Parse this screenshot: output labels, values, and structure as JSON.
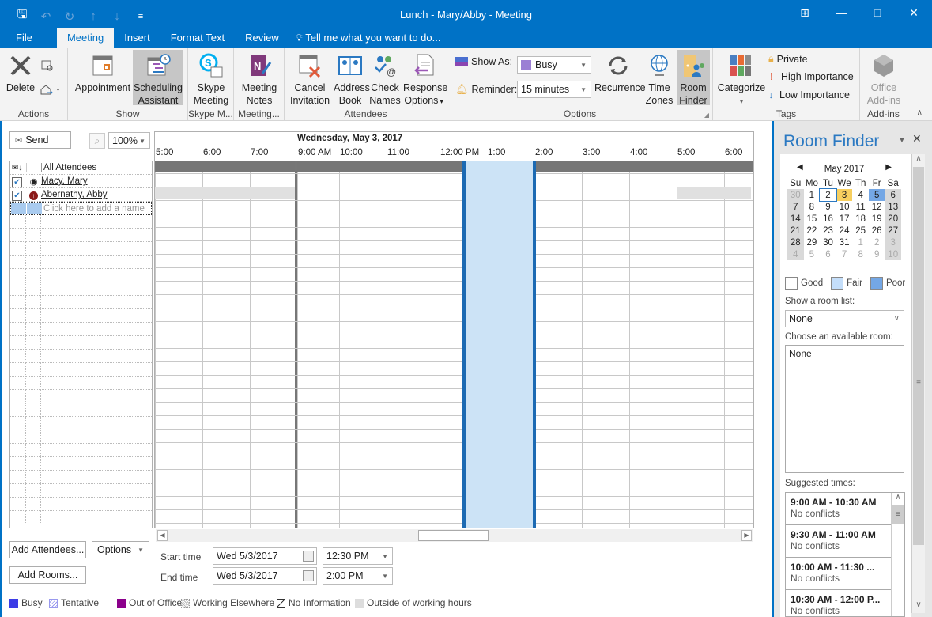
{
  "window": {
    "title": "Lunch - Mary/Abby - Meeting",
    "controls": [
      "restore-ribbon",
      "minimize",
      "maximize",
      "close"
    ]
  },
  "qat": {
    "icons": [
      "save-icon",
      "undo-icon",
      "redo-icon",
      "up-icon",
      "down-icon",
      "customize-icon"
    ]
  },
  "tabs": [
    {
      "label": "File"
    },
    {
      "label": "Meeting"
    },
    {
      "label": "Insert"
    },
    {
      "label": "Format Text"
    },
    {
      "label": "Review"
    },
    {
      "label": "Tell me what you want to do..."
    }
  ],
  "active_tab": "Meeting",
  "ribbon": {
    "actions": {
      "label": "Actions",
      "delete": "Delete"
    },
    "show": {
      "label": "Show",
      "appointment": "Appointment",
      "scheduling_1": "Scheduling",
      "scheduling_2": "Assistant"
    },
    "skype": {
      "label": "Skype M...",
      "btn_1": "Skype",
      "btn_2": "Meeting"
    },
    "meeting_notes": {
      "label": "Meeting...",
      "btn_1": "Meeting",
      "btn_2": "Notes"
    },
    "attendees": {
      "label": "Attendees",
      "cancel_1": "Cancel",
      "cancel_2": "Invitation",
      "address_1": "Address",
      "address_2": "Book",
      "check_1": "Check",
      "check_2": "Names",
      "response_1": "Response",
      "response_2": "Options"
    },
    "options": {
      "label": "Options",
      "show_as_label": "Show As:",
      "show_as_value": "Busy",
      "reminder_label": "Reminder:",
      "reminder_value": "15 minutes",
      "recurrence": "Recurrence",
      "timezones_1": "Time",
      "timezones_2": "Zones",
      "roomfinder_1": "Room",
      "roomfinder_2": "Finder"
    },
    "tags": {
      "label": "Tags",
      "categorize": "Categorize",
      "private": "Private",
      "high": "High Importance",
      "low": "Low Importance"
    },
    "addins": {
      "label": "Add-ins",
      "btn_1": "Office",
      "btn_2": "Add-ins"
    }
  },
  "scheduling": {
    "send": "Send",
    "zoom": "100%",
    "all_attendees": "All Attendees",
    "attendees": [
      {
        "name": "Macy, Mary",
        "checked": true,
        "type": "organizer"
      },
      {
        "name": "Abernathy, Abby",
        "checked": true,
        "type": "required"
      }
    ],
    "add_name_placeholder": "Click here to add a name",
    "date_header": "Wednesday, May 3, 2017",
    "hours_left": [
      "5:00",
      "6:00",
      "7:00"
    ],
    "hours_right": [
      "9:00 AM",
      "10:00",
      "11:00",
      "12:00 PM",
      "1:00",
      "2:00",
      "3:00",
      "4:00",
      "5:00",
      "6:00"
    ],
    "add_attendees": "Add Attendees...",
    "options": "Options",
    "add_rooms": "Add Rooms...",
    "start_label": "Start time",
    "start_date": "Wed 5/3/2017",
    "start_time": "12:30 PM",
    "end_label": "End time",
    "end_date": "Wed 5/3/2017",
    "end_time": "2:00 PM"
  },
  "legend": [
    {
      "label": "Busy",
      "color": "#3c3ce6"
    },
    {
      "label": "Tentative",
      "color": "#9999ee"
    },
    {
      "label": "Out of Office",
      "color": "#8b008b"
    },
    {
      "label": "Working Elsewhere",
      "color": "#999999"
    },
    {
      "label": "No Information",
      "color": "#333333"
    },
    {
      "label": "Outside of working hours",
      "color": "#dddddd"
    }
  ],
  "room_finder": {
    "title": "Room Finder",
    "month": "May 2017",
    "weekdays": [
      "Su",
      "Mo",
      "Tu",
      "We",
      "Th",
      "Fr",
      "Sa"
    ],
    "weeks": [
      [
        "30",
        "1",
        "2",
        "3",
        "4",
        "5",
        "6"
      ],
      [
        "7",
        "8",
        "9",
        "10",
        "11",
        "12",
        "13"
      ],
      [
        "14",
        "15",
        "16",
        "17",
        "18",
        "19",
        "20"
      ],
      [
        "21",
        "22",
        "23",
        "24",
        "25",
        "26",
        "27"
      ],
      [
        "28",
        "29",
        "30",
        "31",
        "1",
        "2",
        "3"
      ],
      [
        "4",
        "5",
        "6",
        "7",
        "8",
        "9",
        "10"
      ]
    ],
    "today": "2",
    "selected": "3",
    "poor_day": "5",
    "good": "Good",
    "fair": "Fair",
    "poor": "Poor",
    "room_list_label": "Show a room list:",
    "room_list_value": "None",
    "available_label": "Choose an available room:",
    "available_value": "None",
    "suggested_label": "Suggested times:",
    "suggested": [
      {
        "time": "9:00 AM - 10:30 AM",
        "status": "No conflicts"
      },
      {
        "time": "9:30 AM - 11:00 AM",
        "status": "No conflicts"
      },
      {
        "time": "10:00 AM - 11:30 ...",
        "status": "No conflicts"
      },
      {
        "time": "10:30 AM - 12:00 P...",
        "status": "No conflicts"
      }
    ]
  }
}
